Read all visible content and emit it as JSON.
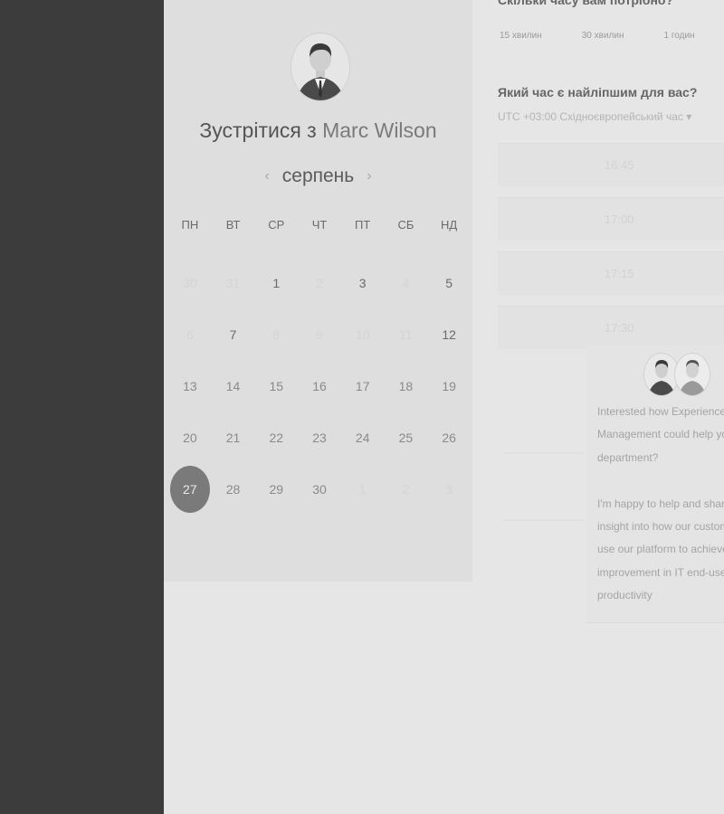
{
  "calendar": {
    "title_prefix": "Зустрітися з",
    "host_name": "Marc Wilson",
    "month": "серпень",
    "prev_icon": "‹",
    "next_icon": "›",
    "weekdays": [
      "ПН",
      "ВТ",
      "СР",
      "ЧТ",
      "ПТ",
      "СБ",
      "НД"
    ],
    "days": [
      {
        "label": "30",
        "state": "muted"
      },
      {
        "label": "31",
        "state": "muted"
      },
      {
        "label": "1",
        "state": "active"
      },
      {
        "label": "2",
        "state": "muted"
      },
      {
        "label": "3",
        "state": "active"
      },
      {
        "label": "4",
        "state": "muted"
      },
      {
        "label": "5",
        "state": "active"
      },
      {
        "label": "6",
        "state": "muted"
      },
      {
        "label": "7",
        "state": "active"
      },
      {
        "label": "8",
        "state": "muted"
      },
      {
        "label": "9",
        "state": "muted"
      },
      {
        "label": "10",
        "state": "muted"
      },
      {
        "label": "11",
        "state": "muted"
      },
      {
        "label": "12",
        "state": "active"
      },
      {
        "label": "13",
        "state": "normal"
      },
      {
        "label": "14",
        "state": "normal"
      },
      {
        "label": "15",
        "state": "normal"
      },
      {
        "label": "16",
        "state": "normal"
      },
      {
        "label": "17",
        "state": "normal"
      },
      {
        "label": "18",
        "state": "normal"
      },
      {
        "label": "19",
        "state": "normal"
      },
      {
        "label": "20",
        "state": "normal"
      },
      {
        "label": "21",
        "state": "normal"
      },
      {
        "label": "22",
        "state": "normal"
      },
      {
        "label": "23",
        "state": "normal"
      },
      {
        "label": "24",
        "state": "normal"
      },
      {
        "label": "25",
        "state": "normal"
      },
      {
        "label": "26",
        "state": "normal"
      },
      {
        "label": "27",
        "state": "selected"
      },
      {
        "label": "28",
        "state": "normal"
      },
      {
        "label": "29",
        "state": "normal"
      },
      {
        "label": "30",
        "state": "normal"
      },
      {
        "label": "1",
        "state": "muted"
      },
      {
        "label": "2",
        "state": "muted"
      },
      {
        "label": "3",
        "state": "muted"
      }
    ]
  },
  "booking": {
    "duration_question": "Скільки часу вам потрібно?",
    "durations": [
      "15 хвилин",
      "30 хвилин",
      "1 годин"
    ],
    "time_question": "Який час є найліпшим для вас?",
    "timezone": "UTC +03:00 Східноєвропейський час ▾",
    "slots": [
      "16:45",
      "17:00",
      "17:15",
      "17:30"
    ]
  },
  "chat": {
    "lines": [
      "Interested how Experience",
      "Management could help yo",
      "department?",
      "",
      "I'm happy to help and shar",
      "insight into how our custom",
      "use our platform to achieve",
      "improvement in IT end-use",
      "productivity"
    ]
  }
}
